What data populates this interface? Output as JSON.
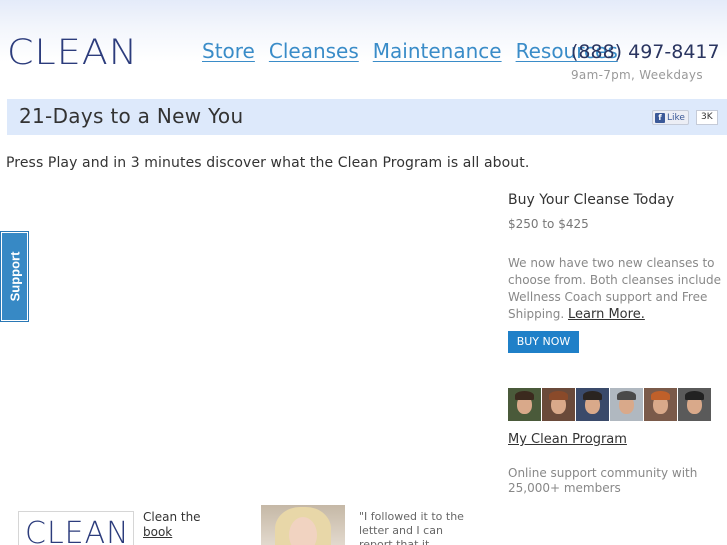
{
  "header": {
    "logo": "CLEAN",
    "nav": [
      {
        "label": "Store"
      },
      {
        "label": "Cleanses"
      },
      {
        "label": "Maintenance"
      },
      {
        "label": "Resources"
      }
    ],
    "phone": "(888) 497-8417",
    "hours": "9am-7pm, Weekdays"
  },
  "title_bar": {
    "title": "21-Days to a New You",
    "like_label": "Like",
    "like_count": "3K"
  },
  "intro": "Press Play and in 3 minutes discover what the Clean Program is all about.",
  "support_tab": "Support",
  "sidebar": {
    "heading": "Buy Your Cleanse Today",
    "price": "$250 to $425",
    "description": "We now have two new cleanses to choose from. Both cleanses include Wellness Coach support and Free Shipping.",
    "learn_more": "Learn More.",
    "buy_button": "BUY NOW",
    "avatars": [
      {
        "name": "member-avatar-1",
        "hair": "#3b2a1e",
        "bg": "#4a5a3a"
      },
      {
        "name": "member-avatar-2",
        "hair": "#8a4a2a",
        "bg": "#6a4a3a"
      },
      {
        "name": "member-avatar-3",
        "hair": "#2a2420",
        "bg": "#3a4a6a"
      },
      {
        "name": "member-avatar-4",
        "hair": "#4a4a4a",
        "bg": "#b0b8c0"
      },
      {
        "name": "member-avatar-5",
        "hair": "#c0602a",
        "bg": "#7a5a4a"
      },
      {
        "name": "member-avatar-6",
        "hair": "#222222",
        "bg": "#5a5a5a"
      }
    ],
    "my_clean_program": "My Clean Program",
    "community": "Online support community with 25,000+ members"
  },
  "bottom": {
    "book_logo": "CLEAN",
    "book_line1": "Clean the",
    "book_link": "book",
    "quote": "\"I followed it to the letter and I can report that it worked"
  },
  "colors": {
    "brand_navy": "#2c3c7c",
    "nav_blue": "#3a8cc8",
    "title_bar_bg": "#dde9fb",
    "button_blue": "#1f80c8"
  }
}
